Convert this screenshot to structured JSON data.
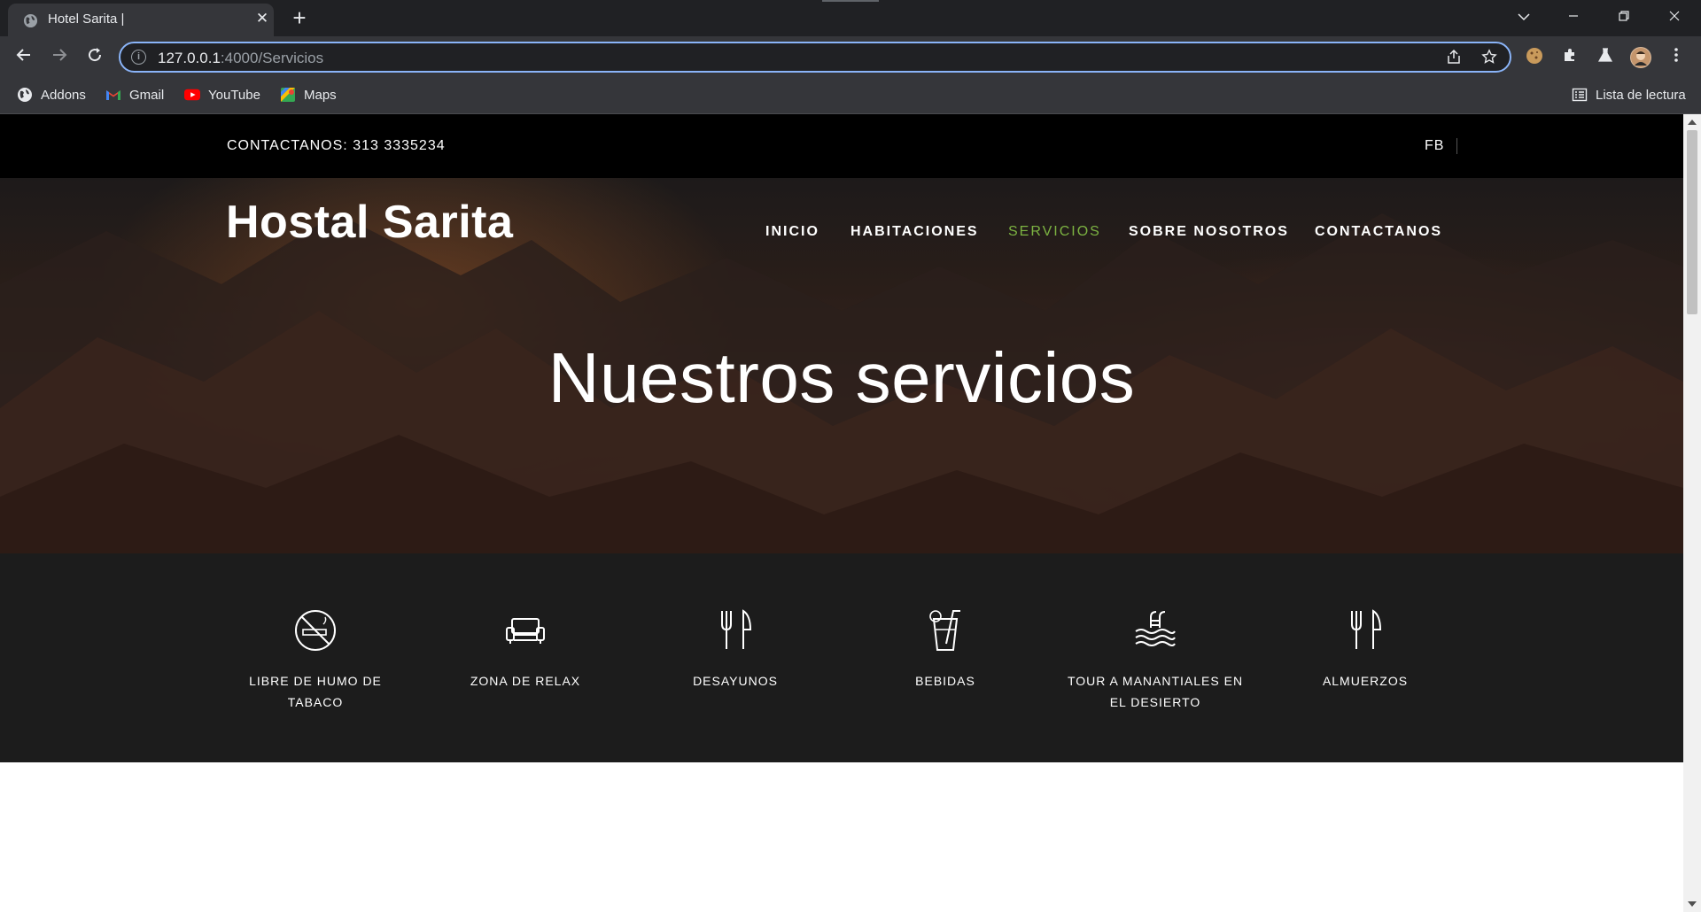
{
  "browser": {
    "tab_title": "Hotel Sarita |",
    "tab_close": "✕",
    "new_tab": "+",
    "url_host": "127.0.0.1",
    "url_path": ":4000/Servicios",
    "bookmarks": [
      {
        "label": "Addons",
        "icon": "globe-icon"
      },
      {
        "label": "Gmail",
        "icon": "gmail-icon"
      },
      {
        "label": "YouTube",
        "icon": "youtube-icon"
      },
      {
        "label": "Maps",
        "icon": "maps-icon"
      }
    ],
    "reading_list": "Lista de lectura",
    "colors": {
      "chrome_dark": "#202124",
      "chrome": "#35363a",
      "focus_ring": "#8ab4f8"
    }
  },
  "site": {
    "contact": "CONTACTANOS: 313 3335234",
    "social": "FB",
    "logo": "Hostal Sarita",
    "nav": [
      {
        "label": "INICIO",
        "active": false
      },
      {
        "label": "HABITACIONES",
        "active": false
      },
      {
        "label": "SERVICIOS",
        "active": true
      },
      {
        "label": "SOBRE NOSOTROS",
        "active": false
      },
      {
        "label": "CONTACTANOS",
        "active": false
      }
    ],
    "hero_title": "Nuestros servicios",
    "services": [
      {
        "label": "LIBRE DE HUMO DE TABACO",
        "icon": "no-smoking-icon"
      },
      {
        "label": "ZONA DE RELAX",
        "icon": "sofa-icon"
      },
      {
        "label": "DESAYUNOS",
        "icon": "fork-knife-icon"
      },
      {
        "label": "BEBIDAS",
        "icon": "drink-icon"
      },
      {
        "label": "TOUR A MANANTIALES EN EL DESIERTO",
        "icon": "pool-icon"
      },
      {
        "label": "ALMUERZOS",
        "icon": "fork-knife-icon"
      }
    ],
    "colors": {
      "accent": "#7cb342",
      "topbar": "#000000",
      "services_bg": "#1c1c1c"
    }
  }
}
